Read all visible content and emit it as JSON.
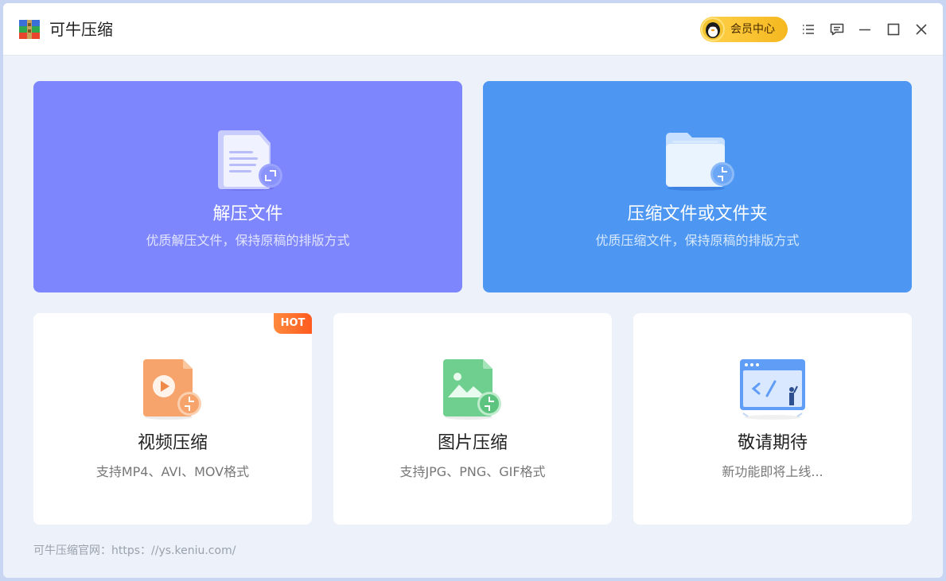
{
  "app": {
    "title": "可牛压缩",
    "logo": "winrar-books-icon"
  },
  "titlebar": {
    "vip_label": "会员中心",
    "icons": [
      "menu-icon",
      "feedback-icon",
      "minimize-icon",
      "maximize-icon",
      "close-icon"
    ]
  },
  "main": {
    "extract": {
      "title": "解压文件",
      "subtitle": "优质解压文件，保持原稿的排版方式",
      "icon": "extract-doc-icon"
    },
    "compress": {
      "title": "压缩文件或文件夹",
      "subtitle": "优质压缩文件，保持原稿的排版方式",
      "icon": "compress-folder-icon"
    }
  },
  "tools": [
    {
      "title": "视频压缩",
      "subtitle": "支持MP4、AVI、MOV格式",
      "badge": "HOT",
      "icon": "video-compress-icon"
    },
    {
      "title": "图片压缩",
      "subtitle": "支持JPG、PNG、GIF格式",
      "icon": "image-compress-icon"
    },
    {
      "title": "敬请期待",
      "subtitle": "新功能即将上线...",
      "icon": "coming-soon-icon"
    }
  ],
  "footer": {
    "text": "可牛压缩官网：https：//ys.keniu.com/"
  },
  "colors": {
    "extract_card": "#7d86fc",
    "compress_card": "#4d97f3",
    "hot_badge": "#ff6a2a",
    "vip": "#f5c232"
  }
}
